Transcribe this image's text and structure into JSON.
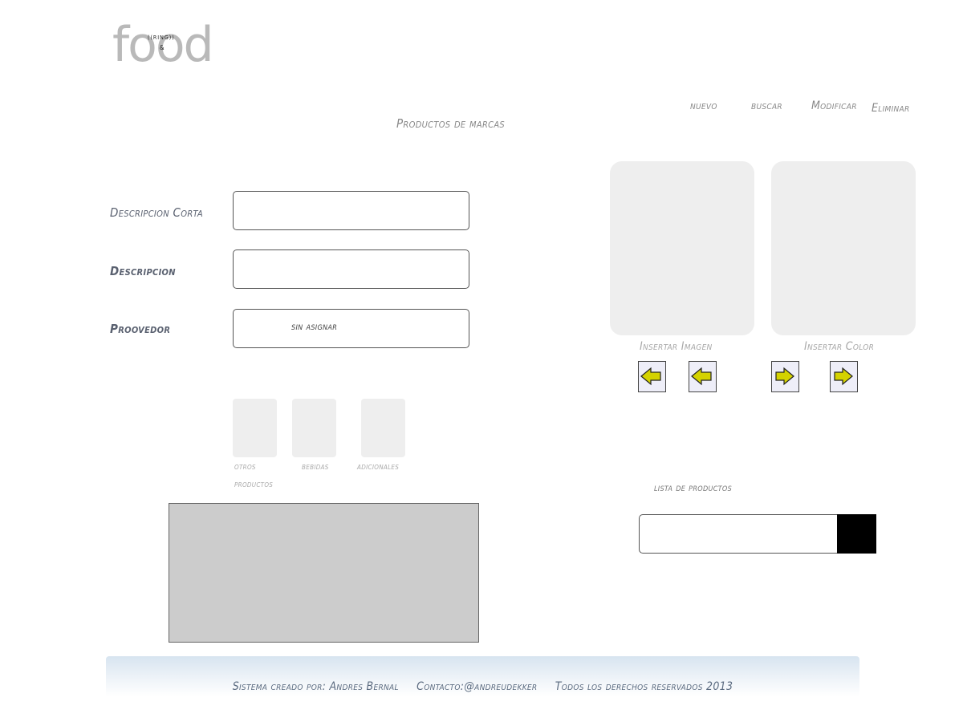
{
  "logo": {
    "food": "food",
    "ring": "((RING))",
    "amp": "&"
  },
  "menu": {
    "nuevo": "nuevo",
    "buscar": "buscar",
    "modificar": "Modificar",
    "eliminar": "Eliminar"
  },
  "page_title": "Productos de marcas",
  "form": {
    "descripcion_corta_label": "Descripcion Corta",
    "descripcion_corta_value": "",
    "descripcion_label": "Descripcion",
    "descripcion_value": "",
    "proveedor_label": "Proovedor",
    "proveedor_value": "sin asignar"
  },
  "categories": [
    {
      "line1": "otros",
      "line2": "productos"
    },
    {
      "line1": "bebidas",
      "line2": ""
    },
    {
      "line1": "adicionales",
      "line2": ""
    }
  ],
  "panels": {
    "imagen_label": "Insertar Imagen",
    "color_label": "Insertar Color"
  },
  "lista": {
    "label": "lista de productos",
    "value": ""
  },
  "footer": {
    "credit": "Sistema creado por: Andres Bernal",
    "contact": "Contacto:@andreudekker",
    "rights": "Todos los derechos reservados  2013"
  },
  "colors": {
    "arrow_fill": "#d4d200",
    "panel_bg": "#eeeeee",
    "preview_bg": "#cccccc"
  },
  "icons": {
    "arrow_left": "arrow-left-icon",
    "arrow_right": "arrow-right-icon"
  }
}
